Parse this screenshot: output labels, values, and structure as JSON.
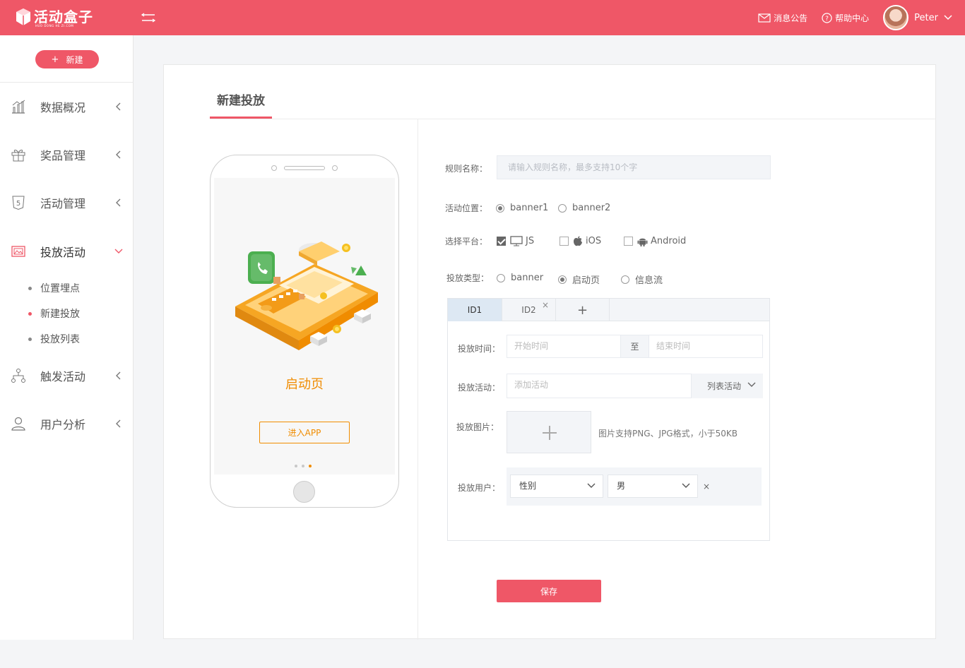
{
  "header": {
    "logo_text": "活动盒子",
    "logo_subtext": "HUO DONG HE ZI.COM",
    "messages_label": "消息公告",
    "help_label": "帮助中心",
    "user_name": "Peter"
  },
  "sidebar": {
    "new_button_label": "新建",
    "items": [
      {
        "label": "数据概况"
      },
      {
        "label": "奖品管理"
      },
      {
        "label": "活动管理"
      },
      {
        "label": "投放活动"
      },
      {
        "label": "触发活动"
      },
      {
        "label": "用户分析"
      }
    ],
    "sub_items": [
      {
        "label": "位置埋点"
      },
      {
        "label": "新建投放"
      },
      {
        "label": "投放列表"
      }
    ]
  },
  "main": {
    "tab_title": "新建投放",
    "phone": {
      "screen_title": "启动页",
      "enter_button": "进入APP"
    },
    "form": {
      "rule_name_label": "规则名称：",
      "rule_name_placeholder": "请输入规则名称，最多支持10个字",
      "position_label": "活动位置：",
      "positions": [
        "banner1",
        "banner2"
      ],
      "platform_label": "选择平台：",
      "platforms": [
        "JS",
        "iOS",
        "Android"
      ],
      "type_label": "投放类型：",
      "types": [
        "banner",
        "启动页",
        "信息流"
      ],
      "id_tabs": [
        "ID1",
        "ID2"
      ],
      "add_tab": "+",
      "close_tab": "×",
      "time_label": "投放时间：",
      "start_placeholder": "开始时间",
      "to_label": "至",
      "end_placeholder": "结束时间",
      "activity_label": "投放活动：",
      "activity_placeholder": "添加活动",
      "activity_select": "列表活动",
      "image_label": "投放图片：",
      "image_hint": "图片支持PNG、JPG格式，小于50KB",
      "user_label": "投放用户：",
      "user_field": "性别",
      "user_value": "男",
      "remove_label": "×",
      "save_button": "保存"
    }
  },
  "colors": {
    "brand": "#ef5767",
    "accent_orange": "#f08c00"
  }
}
